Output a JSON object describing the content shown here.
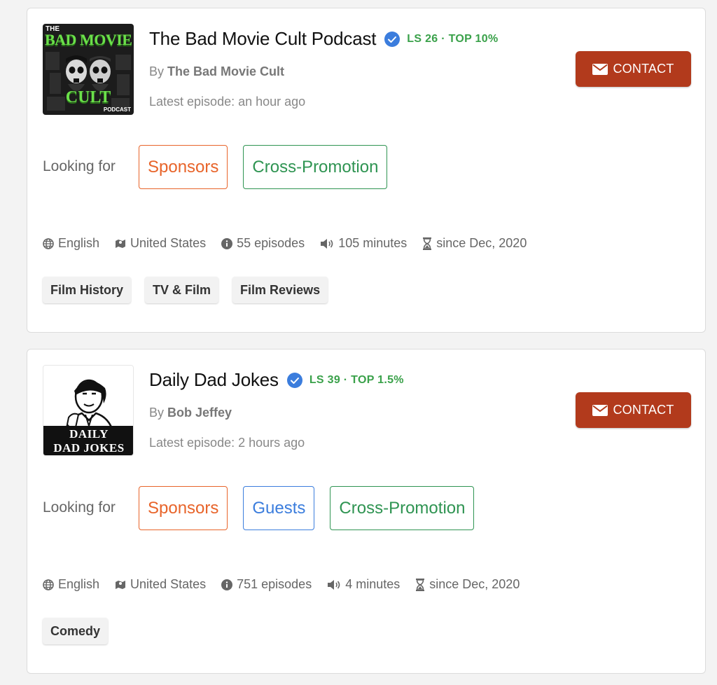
{
  "podcasts": [
    {
      "title": "The Bad Movie Cult Podcast",
      "rank": "LS 26 · TOP 10%",
      "by_prefix": "By",
      "author": "The Bad Movie Cult",
      "latest_episode": "Latest episode: an hour ago",
      "contact_label": "CONTACT",
      "looking_for_label": "Looking for",
      "looking_for": [
        "Sponsors",
        "Cross-Promotion"
      ],
      "language": "English",
      "country": "United States",
      "episodes": "55 episodes",
      "duration": "105 minutes",
      "since": "since Dec, 2020",
      "tags": [
        "Film History",
        "TV & Film",
        "Film Reviews"
      ],
      "cover_text": [
        "THE",
        "BAD MOVIE",
        "CULT",
        "PODCAST"
      ]
    },
    {
      "title": "Daily Dad Jokes",
      "rank": "LS 39 · TOP 1.5%",
      "by_prefix": "By",
      "author": "Bob Jeffey",
      "latest_episode": "Latest episode: 2 hours ago",
      "contact_label": "CONTACT",
      "looking_for_label": "Looking for",
      "looking_for": [
        "Sponsors",
        "Guests",
        "Cross-Promotion"
      ],
      "language": "English",
      "country": "United States",
      "episodes": "751 episodes",
      "duration": "4 minutes",
      "since": "since Dec, 2020",
      "tags": [
        "Comedy"
      ],
      "cover_text": [
        "DAILY",
        "DAD JOKES"
      ]
    }
  ],
  "colors": {
    "contact": "#b23a1c",
    "rank": "#3aa14a",
    "sponsors": "#e8642a",
    "guests": "#3b7ddd",
    "cross_promotion": "#2f9452",
    "verified": "#3b7ddd"
  },
  "icons": {
    "verified": "verified-check-icon",
    "language": "globe-icon",
    "country": "map-icon",
    "episodes": "info-icon",
    "duration": "volume-icon",
    "since": "hourglass-icon",
    "contact": "envelope-icon"
  }
}
